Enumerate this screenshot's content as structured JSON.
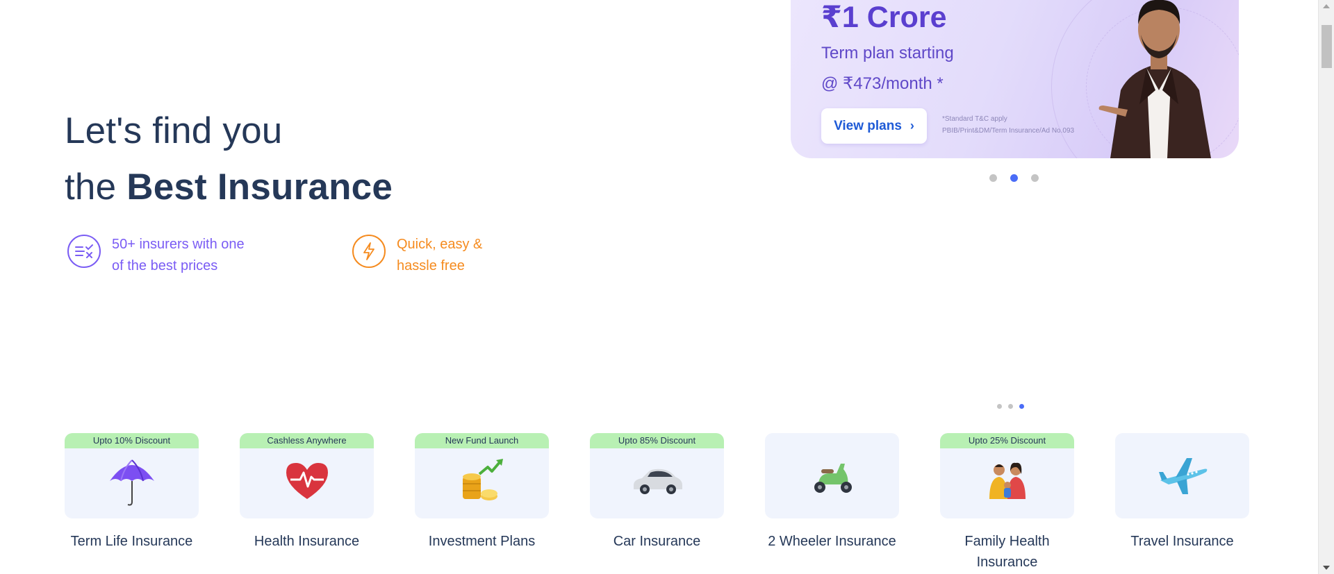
{
  "hero": {
    "title_line1": "Let's find you",
    "title_prefix": "the",
    "title_bold": "Best Insurance"
  },
  "features": [
    {
      "icon": "compare-icon",
      "line1": "50+ insurers with one",
      "line2": "of the best prices",
      "color": "#7a5cf4"
    },
    {
      "icon": "lightning-icon",
      "line1": "Quick, easy &",
      "line2": "hassle free",
      "color": "#f58b1f"
    }
  ],
  "banner": {
    "amount": "₹1 Crore",
    "subtitle1": "Term plan starting",
    "subtitle2": "@ ₹473/month *",
    "button_label": "View plans",
    "button_icon": "chevron-right-icon",
    "tc_line1": "*Standard T&C apply",
    "tc_line2": "PBIB/Print&DM/Term Insurance/Ad No.093"
  },
  "banner_carousel": {
    "count": 3,
    "active_index": 1
  },
  "products_carousel": {
    "count": 3,
    "active_index": 2
  },
  "products": [
    {
      "label": "Term Life Insurance",
      "badge": "Upto 10% Discount",
      "icon": "umbrella-icon"
    },
    {
      "label": "Health Insurance",
      "badge": "Cashless Anywhere",
      "icon": "heart-pulse-icon"
    },
    {
      "label": "Investment Plans",
      "badge": "New Fund Launch",
      "icon": "coins-growth-icon"
    },
    {
      "label": "Car Insurance",
      "badge": "Upto 85% Discount",
      "icon": "car-icon"
    },
    {
      "label": "2 Wheeler Insurance",
      "badge": "",
      "icon": "scooter-icon"
    },
    {
      "label": "Family Health Insurance",
      "badge": "Upto 25% Discount",
      "icon": "family-icon"
    },
    {
      "label": "Travel Insurance",
      "badge": "",
      "icon": "airplane-icon"
    }
  ],
  "colors": {
    "primary_text": "#253858",
    "accent_purple": "#7a5cf4",
    "accent_orange": "#f58b1f",
    "badge_green": "#b8f0b3",
    "card_bg": "#f0f4fd",
    "active_dot": "#4a6cf7"
  }
}
